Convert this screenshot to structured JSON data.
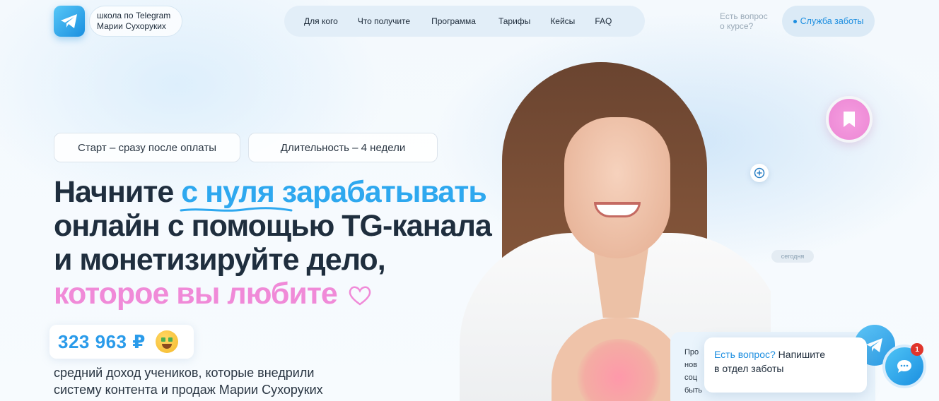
{
  "header": {
    "logo_text_line1": "школа по Telegram",
    "logo_text_line2": "Марии Сухоруких",
    "nav": [
      "Для кого",
      "Что получите",
      "Программа",
      "Тарифы",
      "Кейсы",
      "FAQ"
    ],
    "question_line1": "Есть вопрос",
    "question_line2": "о курсе?",
    "support_label": "Служба заботы"
  },
  "hero": {
    "pill_start": "Старт – сразу после оплаты",
    "pill_duration": "Длительность – 4 недели",
    "headline": {
      "part1": "Начните ",
      "part2_underlined": "с нуля з",
      "part3": "арабатывать",
      "line2": "онлайн с помощью TG-канала",
      "line3": "и монетизируйте дело,",
      "line4": "которое вы любите"
    },
    "income_value": "323 963 ₽",
    "income_desc_line1": "средний доход учеников, которые внедрили",
    "income_desc_line2": "систему контента и продаж Марии Сухоруких"
  },
  "floating": {
    "today_badge": "сегодня"
  },
  "chat": {
    "preview_line1": "Про",
    "preview_line2": "нов",
    "preview_line3": "соц",
    "preview_line4": "быть",
    "popup_question": "Есть вопрос?",
    "popup_rest_1": " Напишите",
    "popup_line2": "в отдел заботы",
    "badge_count": "1"
  },
  "colors": {
    "accent_blue": "#2ea8ef",
    "accent_pink": "#f08ad8",
    "text_dark": "#1f2e3e"
  }
}
